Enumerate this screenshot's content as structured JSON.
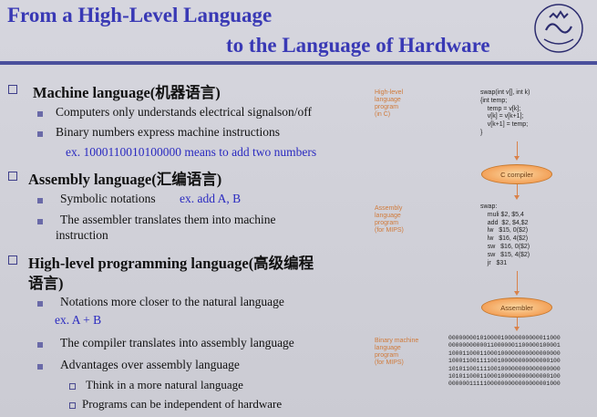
{
  "title": {
    "line1": "From a High-Level Language",
    "line2": "to the Language of Hardware"
  },
  "sections": {
    "machine": {
      "heading": "Machine language(机器语言)",
      "bullets": [
        "Computers only understands electrical signalson/off",
        "Binary numbers express machine instructions"
      ],
      "example": "ex.   1000110010100000 means to add two numbers"
    },
    "assembly": {
      "heading": "Assembly language(汇编语言)",
      "bullet1_text": "Symbolic notations",
      "bullet1_example": "ex.    add A, B",
      "bullet2_line1": "The assembler translates them into machine",
      "bullet2_line2": "instruction"
    },
    "highlevel": {
      "heading_line1": "High-level programming language(高级编程",
      "heading_line2": "语言)",
      "bullet1": "Notations more closer to the natural language",
      "bullet1_example": "ex.  A + B",
      "bullet2": "The compiler translates into assembly language",
      "bullet3": "Advantages over assembly language",
      "sub1": "Think in a more natural language",
      "sub2": "Programs can be independent of hardware"
    }
  },
  "diagram": {
    "hl_label": "High-level\nlanguage\nprogram\n(in C)",
    "hl_code": "swap(int v[], int k)\n{int temp;\n    temp = v[k];\n    v[k] = v[k+1];\n    v[k+1] = temp;\n}",
    "compiler_label": "C compiler",
    "asm_label": "Assembly\nlanguage\nprogram\n(for MIPS)",
    "asm_code": "swap:\n    muli $2, $5,4\n    add  $2, $4,$2\n    lw   $15, 0($2)\n    lw   $16, 4($2)\n    sw   $16, 0($2)\n    sw   $15, 4($2)\n    jr   $31",
    "assembler_label": "Assembler",
    "bin_label": "Binary machine\nlanguage\nprogram\n(for MIPS)",
    "bin_code": "00000000101000010000000000011000\n00000000000110000001100000100001\n10001100011000100000000000000000\n10001100111100100000000000000100\n10101100111100100000000000000000\n10101100011000100000000000000100\n00000011111000000000000000001000"
  },
  "colors": {
    "title": "#3939b5",
    "example_text": "#2a2ac0",
    "diagram_label": "#d07a3a",
    "oval": "#f3a25a"
  }
}
